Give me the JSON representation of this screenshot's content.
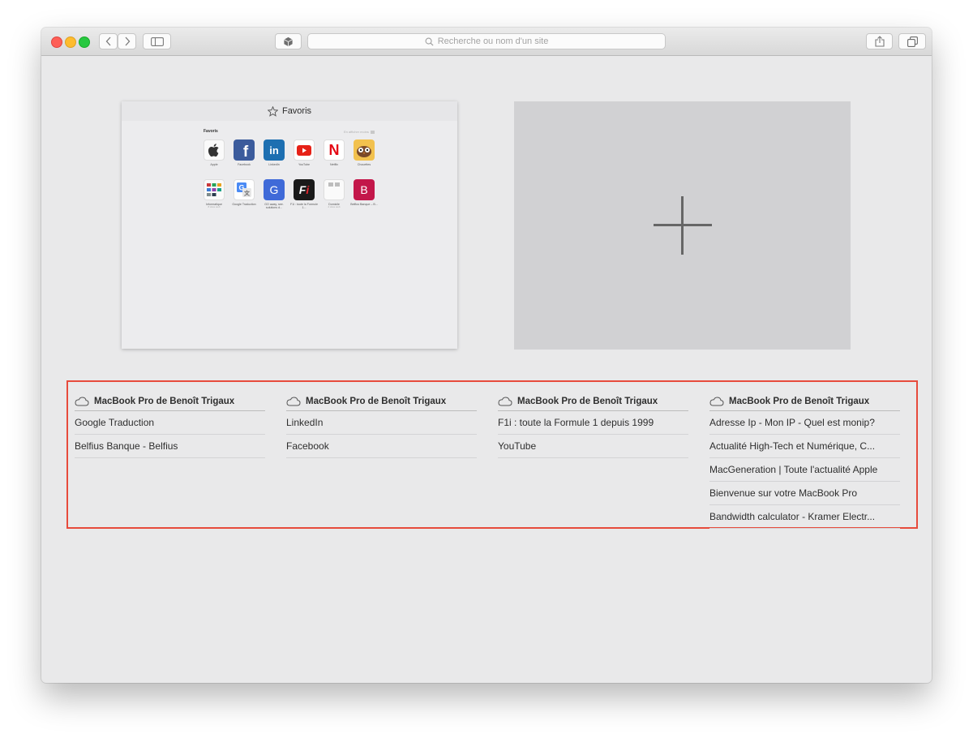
{
  "toolbar": {
    "address_placeholder": "Recherche ou nom d'un site",
    "icons": [
      "chevron-left-icon",
      "chevron-right-icon",
      "sidebar-icon",
      "cube-icon",
      "search-icon",
      "share-icon",
      "tabs-overview-icon"
    ]
  },
  "favorites_preview": {
    "header_title": "Favoris",
    "section_label": "Favoris",
    "show_less": "En afficher moins",
    "tiles": [
      {
        "label": "Apple",
        "sub": ""
      },
      {
        "label": "Facebook",
        "sub": ""
      },
      {
        "label": "LinkedIn",
        "sub": ""
      },
      {
        "label": "YouTube",
        "sub": ""
      },
      {
        "label": "Netflix",
        "sub": ""
      },
      {
        "label": "Chouettes",
        "sub": ""
      },
      {
        "label": "Informatique",
        "sub": "8 sites web"
      },
      {
        "label": "Google Traduction",
        "sub": ""
      },
      {
        "label": "GO away, see. solutions d...",
        "sub": ""
      },
      {
        "label": "F1i : toute la Formule 1...",
        "sub": ""
      },
      {
        "label": "Domicile",
        "sub": "2 sites web"
      },
      {
        "label": "Belfius Banque – B...",
        "sub": ""
      }
    ]
  },
  "new_tab": {
    "icon": "plus-icon"
  },
  "icloud_tabs": [
    {
      "device": "MacBook Pro de Benoît Trigaux",
      "tabs": [
        "Google Traduction",
        "Belfius Banque - Belfius"
      ]
    },
    {
      "device": "MacBook Pro de Benoît Trigaux",
      "tabs": [
        "LinkedIn",
        "Facebook"
      ]
    },
    {
      "device": "MacBook Pro de Benoît Trigaux",
      "tabs": [
        "F1i : toute la Formule 1 depuis 1999",
        "YouTube"
      ]
    },
    {
      "device": "MacBook Pro de Benoît Trigaux",
      "tabs": [
        "Adresse Ip - Mon IP - Quel est monip?",
        "Actualité High-Tech et Numérique, C...",
        "MacGeneration | Toute l'actualité Apple",
        "Bienvenue sur votre MacBook Pro",
        "Bandwidth calculator - Kramer Electr..."
      ]
    }
  ],
  "colors": {
    "highlight": "#e74b3c",
    "window_bg": "#e9e9ea",
    "new_tab_bg": "#d1d1d3"
  }
}
